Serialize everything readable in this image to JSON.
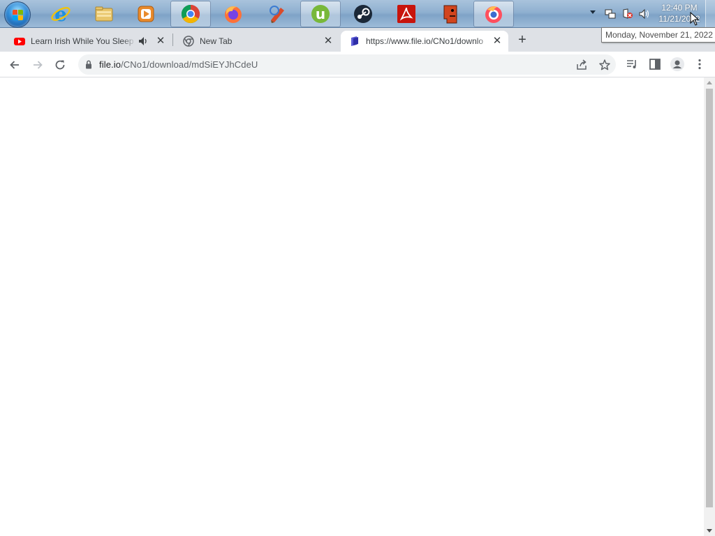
{
  "taskbar": {
    "apps": [
      {
        "name": "Internet Explorer",
        "icon": "ie-icon"
      },
      {
        "name": "Windows Explorer",
        "icon": "folder-icon"
      },
      {
        "name": "Media Player",
        "icon": "media-player-icon"
      },
      {
        "name": "Google Chrome",
        "icon": "chrome-icon"
      },
      {
        "name": "Firefox",
        "icon": "firefox-icon"
      },
      {
        "name": "CCleaner",
        "icon": "ccleaner-icon"
      },
      {
        "name": "uTorrent",
        "icon": "utorrent-icon"
      },
      {
        "name": "Steam",
        "icon": "steam-icon"
      },
      {
        "name": "Adobe Reader",
        "icon": "adobe-reader-icon"
      },
      {
        "name": "Red Head App",
        "icon": "red-head-icon"
      },
      {
        "name": "Firefox Nightly",
        "icon": "firefox-nightly-icon"
      }
    ],
    "clock_time": "12:40 PM",
    "clock_date": "11/21/2022",
    "tooltip": "Monday, November 21, 2022"
  },
  "tabs": [
    {
      "title": "Learn Irish While You Sleep F",
      "favicon": "youtube-icon"
    },
    {
      "title": "New Tab",
      "favicon": "chrome-icon"
    },
    {
      "title": "https://www.file.io/CNo1/downlo",
      "favicon": "file-io-icon"
    }
  ],
  "omnibox": {
    "host": "file.io",
    "path": "/CNo1/download/mdSiEYJhCdeU"
  },
  "colors": {
    "tabstrip": "#dee1e6",
    "omnibox_bg": "#f1f3f4",
    "taskbar": "#8fb0d0"
  }
}
